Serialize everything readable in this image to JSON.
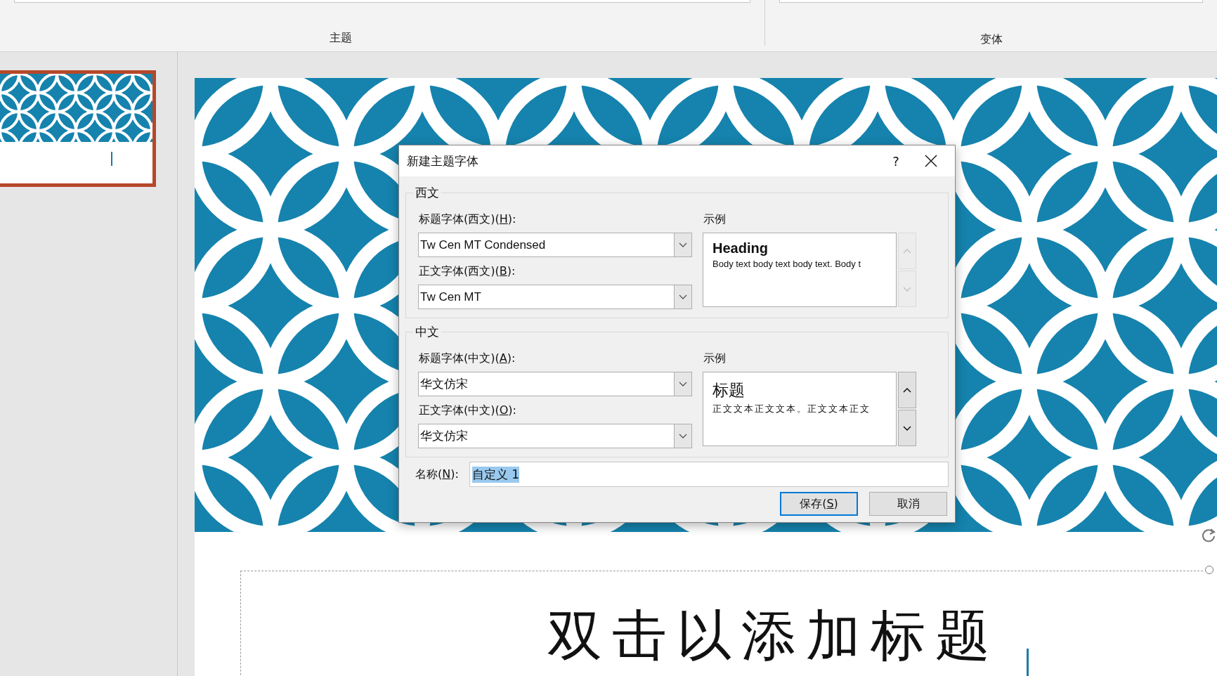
{
  "ribbon": {
    "groups": [
      {
        "label": "主题"
      },
      {
        "label": "变体"
      }
    ]
  },
  "slides_panel": {
    "thumbnails": [
      {
        "selected": true
      }
    ]
  },
  "slide": {
    "title_placeholder": "双击以添加标题"
  },
  "dialog": {
    "title": "新建主题字体",
    "help": "?",
    "sections": [
      {
        "legend": "西文",
        "kind": "western",
        "sample_label": "示例",
        "sample_heading": "Heading",
        "sample_body": "Body text body text body text. Body t",
        "scroll_up": {
          "disabled": true
        },
        "scroll_down": {
          "disabled": true
        },
        "fields": [
          {
            "label": "标题字体(西文)(",
            "access_key": "H",
            "label_end": "):",
            "value": "Tw Cen MT Condensed"
          },
          {
            "label": "正文字体(西文)(",
            "access_key": "B",
            "label_end": "):",
            "value": "Tw Cen MT"
          }
        ]
      },
      {
        "legend": "中文",
        "kind": "chinese",
        "sample_label": "示例",
        "sample_heading": "标题",
        "sample_body": "正文文本正文文本。正文文本正文",
        "scroll_up": {
          "disabled": false
        },
        "scroll_down": {
          "disabled": false
        },
        "fields": [
          {
            "label": "标题字体(中文)(",
            "access_key": "A",
            "label_end": "):",
            "value": "华文仿宋"
          },
          {
            "label": "正文字体(中文)(",
            "access_key": "O",
            "label_end": "):",
            "value": "华文仿宋"
          }
        ]
      }
    ],
    "name": {
      "label": "名称(",
      "access_key": "N",
      "label_end": "):",
      "value": "自定义 1",
      "value_selected": true
    },
    "buttons": [
      {
        "label": "保存(",
        "access_key": "S",
        "label_end": ")",
        "default": true
      },
      {
        "label": "取消",
        "default": false
      }
    ]
  }
}
